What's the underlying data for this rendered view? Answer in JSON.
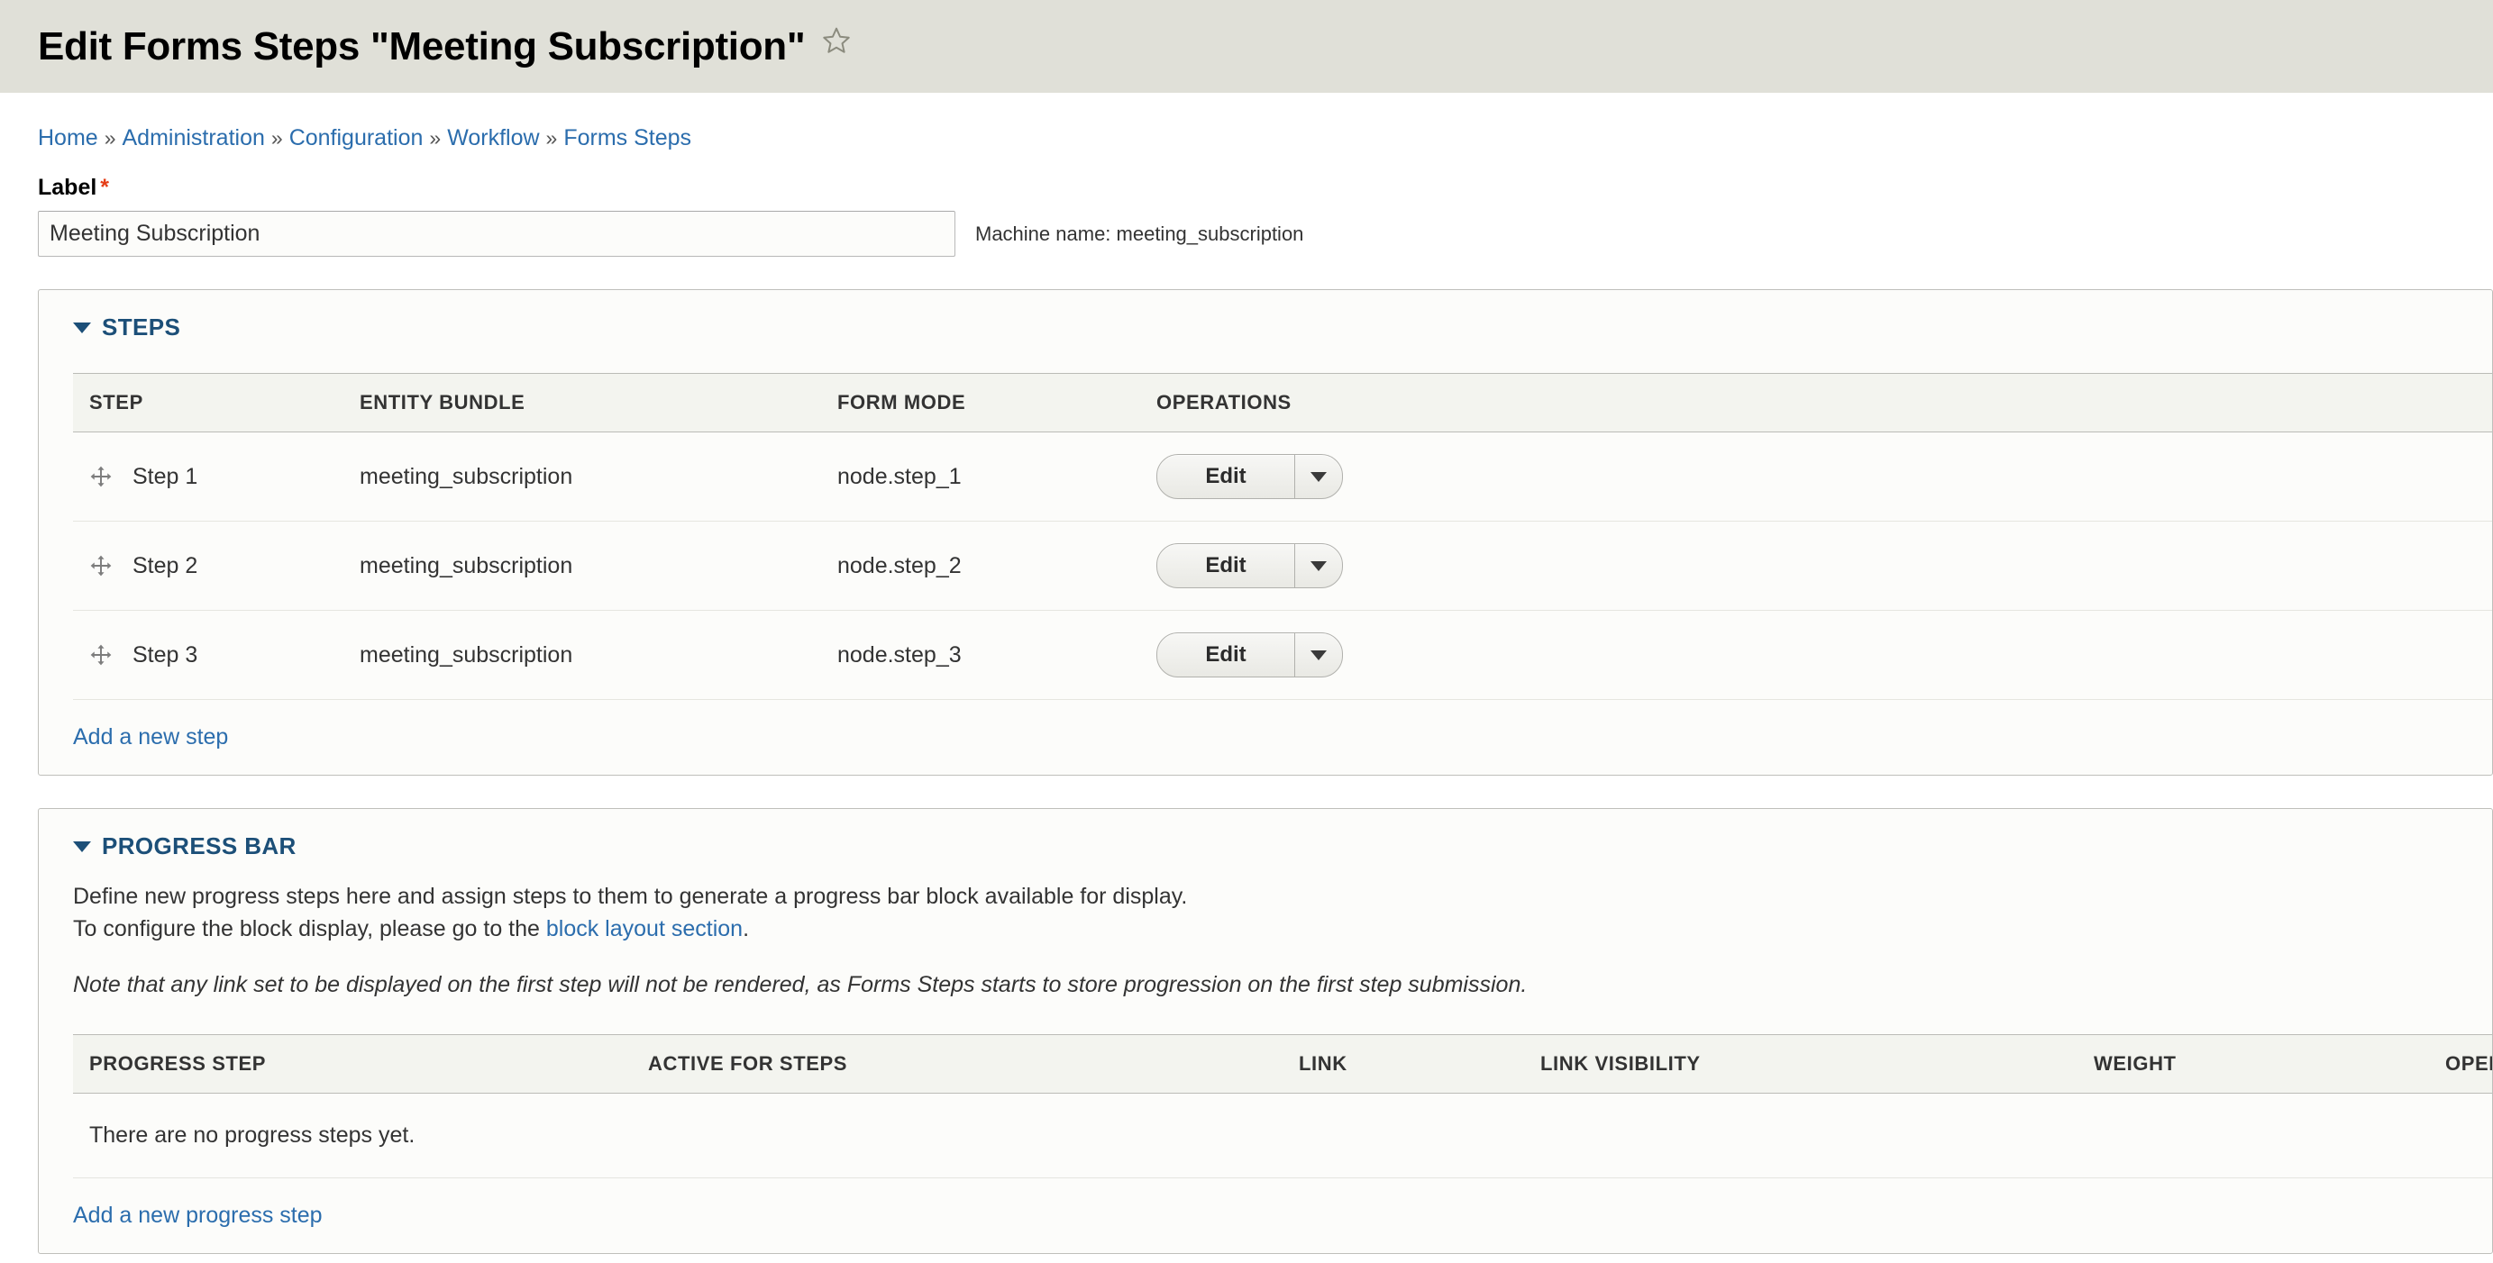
{
  "header": {
    "title": "Edit Forms Steps \"Meeting Subscription\"",
    "star_icon": "star-outline-icon"
  },
  "breadcrumb": {
    "separator": "»",
    "items": [
      {
        "label": "Home"
      },
      {
        "label": "Administration"
      },
      {
        "label": "Configuration"
      },
      {
        "label": "Workflow"
      },
      {
        "label": "Forms Steps"
      }
    ]
  },
  "label_field": {
    "label": "Label",
    "required_mark": "*",
    "value": "Meeting Subscription",
    "placeholder": "",
    "machine_name": "Machine name: meeting_subscription"
  },
  "steps_panel": {
    "summary": "STEPS",
    "columns": [
      "STEP",
      "ENTITY BUNDLE",
      "FORM MODE",
      "OPERATIONS"
    ],
    "rows": [
      {
        "drag_icon": "drag-move-icon",
        "step": "Step 1",
        "entity_bundle": "meeting_subscription",
        "form_mode": "node.step_1",
        "operation_label": "Edit",
        "operation_toggle_icon": "chevron-down-icon"
      },
      {
        "drag_icon": "drag-move-icon",
        "step": "Step 2",
        "entity_bundle": "meeting_subscription",
        "form_mode": "node.step_2",
        "operation_label": "Edit",
        "operation_toggle_icon": "chevron-down-icon"
      },
      {
        "drag_icon": "drag-move-icon",
        "step": "Step 3",
        "entity_bundle": "meeting_subscription",
        "form_mode": "node.step_3",
        "operation_label": "Edit",
        "operation_toggle_icon": "chevron-down-icon"
      }
    ],
    "add_link": "Add a new step"
  },
  "progress_panel": {
    "summary": "PROGRESS BAR",
    "description_line1": "Define new progress steps here and assign steps to them to generate a progress bar block available for display.",
    "description_line2_prefix": "To configure the block display, please go to the ",
    "description_link": "block layout section",
    "description_line2_suffix": ".",
    "note": "Note that any link set to be displayed on the first step will not be rendered, as Forms Steps starts to store progression on the first step submission.",
    "columns": [
      "PROGRESS STEP",
      "ACTIVE FOR STEPS",
      "LINK",
      "LINK VISIBILITY",
      "WEIGHT",
      "OPERATIONS"
    ],
    "empty_message": "There are no progress steps yet.",
    "add_link": "Add a new progress step"
  },
  "colors": {
    "title_bar_bg": "#e0e0d8",
    "link": "#2b6dad",
    "summary": "#1c4f78",
    "required": "#e53d16",
    "panel_bg": "#fcfcfa",
    "table_head_bg": "#f3f4ef"
  }
}
